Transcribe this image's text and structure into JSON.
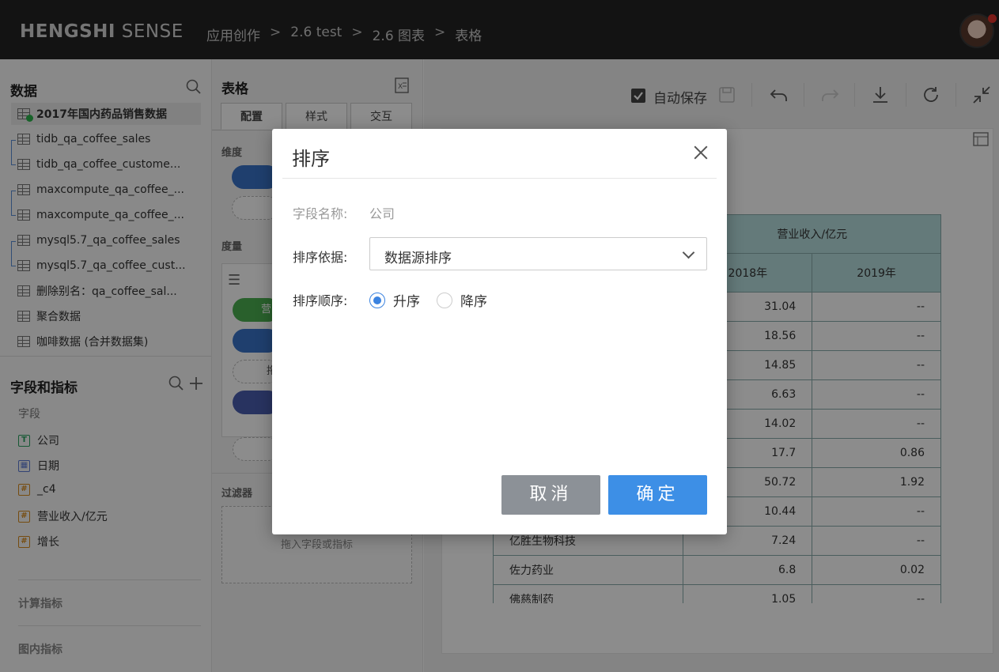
{
  "header": {
    "brand_bold": "HENGSHI",
    "brand_rest": "SENSE",
    "breadcrumb": [
      "应用创作",
      "2.6 test",
      "2.6 图表",
      "表格"
    ],
    "separator": ">"
  },
  "data_panel": {
    "title": "数据",
    "datasets": [
      "2017年国内药品销售数据",
      "tidb_qa_coffee_sales",
      "tidb_qa_coffee_custome...",
      "maxcompute_qa_coffee_...",
      "maxcompute_qa_coffee_...",
      "mysql5.7_qa_coffee_sales",
      "mysql5.7_qa_coffee_cust...",
      "删除别名：qa_coffee_sal...",
      "聚合数据",
      "咖啡数据 (合并数据集)"
    ]
  },
  "fields_panel": {
    "title": "字段和指标",
    "fields_label": "字段",
    "fields": [
      {
        "name": "公司",
        "icon": "text-type-icon",
        "glyph": "T"
      },
      {
        "name": "日期",
        "icon": "date-type-icon",
        "glyph": "▦"
      },
      {
        "name": "_c4",
        "icon": "number-type-icon",
        "glyph": "#"
      },
      {
        "name": "营业收入/亿元",
        "icon": "number-type-icon",
        "glyph": "#"
      },
      {
        "name": "增长",
        "icon": "number-type-icon",
        "glyph": "#"
      }
    ],
    "calc_label": "计算指标",
    "chart_label": "图内指标"
  },
  "config_panel": {
    "title": "表格",
    "tabs": [
      "配置",
      "样式",
      "交互"
    ],
    "dimension_label": "维度",
    "measure_label": "度量",
    "measure_pill_text": "营",
    "filter_label": "过滤器",
    "filter_placeholder": "拖入字段或指标",
    "drag_hint": "拖"
  },
  "toolbar": {
    "autosave_label": "自动保存",
    "autosave_checked": true
  },
  "table": {
    "group_header": "营业收入/亿元",
    "columns": [
      "2018年",
      "2019年"
    ],
    "rows": [
      {
        "name": "",
        "y2018": "31.04",
        "y2019": "--"
      },
      {
        "name": "",
        "y2018": "18.56",
        "y2019": "--"
      },
      {
        "name": "",
        "y2018": "14.85",
        "y2019": "--"
      },
      {
        "name": "",
        "y2018": "6.63",
        "y2019": "--"
      },
      {
        "name": "",
        "y2018": "14.02",
        "y2019": "--"
      },
      {
        "name": "",
        "y2018": "17.7",
        "y2019": "0.86"
      },
      {
        "name": "",
        "y2018": "50.72",
        "y2019": "1.92"
      },
      {
        "name": "",
        "y2018": "10.44",
        "y2019": "--"
      },
      {
        "name": "亿胜生物科技",
        "y2018": "7.24",
        "y2019": "--"
      },
      {
        "name": "佐力药业",
        "y2018": "6.8",
        "y2019": "0.02"
      },
      {
        "name": "佛慈制药",
        "y2018": "1.05",
        "y2019": "--"
      }
    ]
  },
  "dialog": {
    "title": "排序",
    "field_name_label": "字段名称:",
    "field_name_value": "公司",
    "sort_by_label": "排序依据:",
    "sort_by_value": "数据源排序",
    "order_label": "排序顺序:",
    "order_asc": "升序",
    "order_desc": "降序",
    "selected_order": "asc",
    "cancel_label": "取消",
    "ok_label": "确定"
  }
}
